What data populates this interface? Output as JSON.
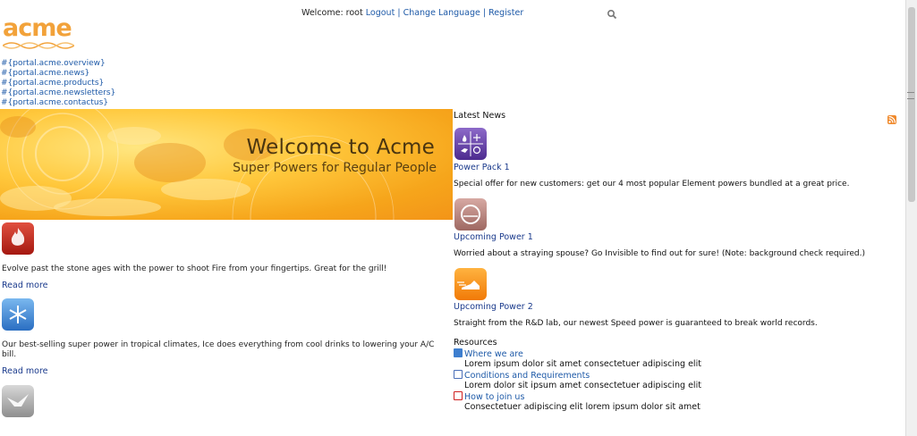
{
  "header": {
    "welcome": "Welcome: root",
    "logout": "Logout",
    "sep1": "|",
    "change_language": "Change Language",
    "sep2": "|",
    "register": "Register",
    "logo_text": "acme"
  },
  "nav": {
    "items": [
      "#{portal.acme.overview}",
      "#{portal.acme.news}",
      "#{portal.acme.products}",
      "#{portal.acme.newsletters}",
      "#{portal.acme.contactus}"
    ]
  },
  "banner": {
    "title": "Welcome to Acme",
    "subtitle": "Super Powers for Regular People"
  },
  "powers": [
    {
      "icon": "fire-icon",
      "text": "Evolve past the stone ages with the power to shoot Fire from your fingertips. Great for the grill!",
      "read_more": "Read more"
    },
    {
      "icon": "snowflake-icon",
      "text": "Our best-selling super power in tropical climates, Ice does everything from cool drinks to lowering your A/C bill.",
      "read_more": "Read more"
    },
    {
      "icon": "bird-icon"
    }
  ],
  "latest_news": {
    "heading": "Latest News",
    "items": [
      {
        "icon": "element-pack-icon",
        "title": "Power Pack 1",
        "text": "Special offer for new customers: get our 4 most popular Element powers bundled at a great price."
      },
      {
        "icon": "invisible-icon",
        "title": "Upcoming Power 1",
        "text": "Worried about a straying spouse? Go Invisible to find out for sure! (Note: background check required.)"
      },
      {
        "icon": "speed-shoe-icon",
        "title": "Upcoming Power 2",
        "text": "Straight from the R&D lab, our newest Speed power is guaranteed to break world records."
      }
    ]
  },
  "resources": {
    "heading": "Resources",
    "items": [
      {
        "icon": "excel-file-icon",
        "title": "Where we are",
        "desc": "Lorem ipsum dolor sit amet consectetuer adipiscing elit"
      },
      {
        "icon": "word-file-icon",
        "title": "Conditions and Requirements",
        "desc": "Lorem dolor sit ipsum amet consectetuer adipiscing elit"
      },
      {
        "icon": "pdf-file-icon",
        "title": "How to join us",
        "desc": "Consectetuer adipiscing elit lorem ipsum dolor sit amet"
      }
    ]
  },
  "colors": {
    "accent": "#f39418",
    "link": "#1e5aa8",
    "title_link": "#1a3a8c"
  }
}
